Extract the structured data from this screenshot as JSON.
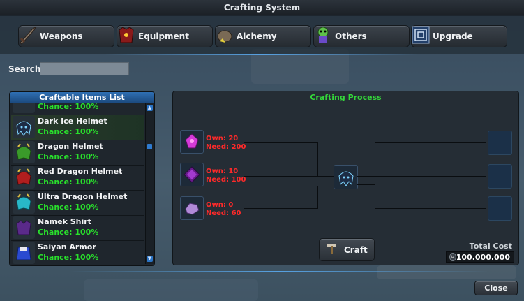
{
  "window": {
    "title": "Crafting System"
  },
  "tabs": [
    {
      "label": "Weapons",
      "icon": "sword-icon"
    },
    {
      "label": "Equipment",
      "icon": "armor-icon"
    },
    {
      "label": "Alchemy",
      "icon": "alchemy-icon"
    },
    {
      "label": "Others",
      "icon": "creature-icon"
    },
    {
      "label": "Upgrade",
      "icon": "upgrade-icon"
    }
  ],
  "search": {
    "label": "Search",
    "value": "",
    "placeholder": ""
  },
  "craftable_list": {
    "title": "Craftable Items List",
    "items": [
      {
        "name": "",
        "chance": "Chance: 100%",
        "icon": "partial-item-icon"
      },
      {
        "name": "Dark Ice Helmet",
        "chance": "Chance: 100%",
        "icon": "dark-ice-helmet-icon",
        "selected": true
      },
      {
        "name": "Dragon Helmet",
        "chance": "Chance: 100%",
        "icon": "dragon-helmet-icon"
      },
      {
        "name": "Red Dragon Helmet",
        "chance": "Chance: 100%",
        "icon": "red-dragon-helmet-icon"
      },
      {
        "name": "Ultra Dragon Helmet",
        "chance": "Chance: 100%",
        "icon": "ultra-dragon-helmet-icon"
      },
      {
        "name": "Namek Shirt",
        "chance": "Chance: 100%",
        "icon": "namek-shirt-icon"
      },
      {
        "name": "Saiyan Armor",
        "chance": "Chance: 100%",
        "icon": "saiyan-armor-icon"
      }
    ]
  },
  "crafting": {
    "title": "Crafting Process",
    "materials": [
      {
        "own": "Own: 20",
        "need": "Need: 200",
        "icon": "pink-crystal-icon"
      },
      {
        "own": "Own: 10",
        "need": "Need: 100",
        "icon": "purple-gem-icon"
      },
      {
        "own": "Own: 0",
        "need": "Need: 60",
        "icon": "lavender-ore-icon"
      }
    ],
    "result_icon": "dark-ice-helmet-icon",
    "craft_label": "Craft",
    "total_cost_label": "Total Cost",
    "total_cost_value": "100.000.000"
  },
  "close_label": "Close",
  "colors": {
    "accent": "#2f6fb3",
    "chance_green": "#29e02c",
    "need_red": "#ff2a2a",
    "title_green": "#34d63a"
  }
}
